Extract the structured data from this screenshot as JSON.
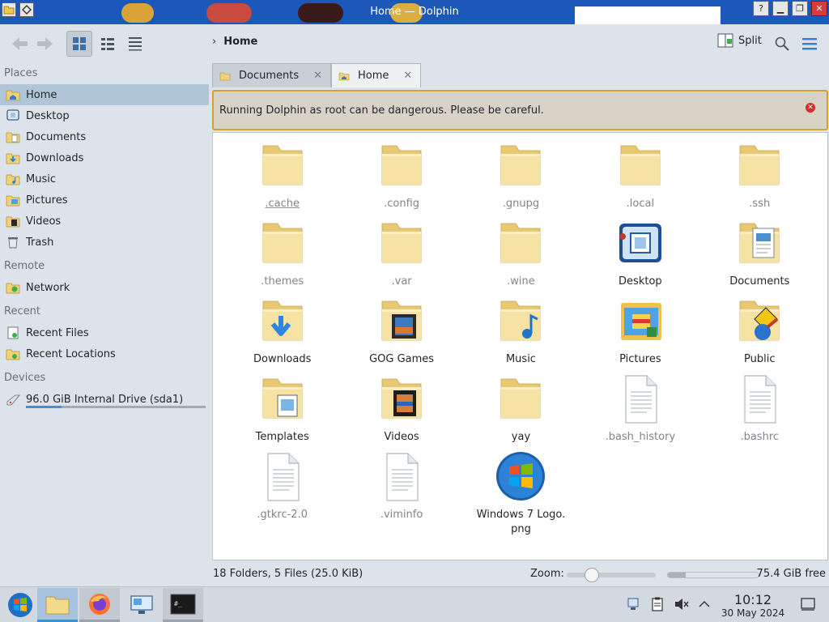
{
  "window": {
    "title": "Home — Dolphin",
    "controls": [
      "help",
      "minimize",
      "maximize",
      "close"
    ]
  },
  "toolbar": {
    "back_icon": "arrow-left-icon",
    "forward_icon": "arrow-right-icon",
    "view_modes": [
      "icons-view",
      "compact-view",
      "details-view"
    ],
    "active_view": "icons-view",
    "breadcrumb": [
      "Home"
    ],
    "split_label": "Split",
    "search_icon": "search-icon",
    "menu_icon": "hamburger-menu-icon"
  },
  "sidebar": {
    "places_header": "Places",
    "places": [
      {
        "label": "Home",
        "icon": "home-folder-icon",
        "active": true
      },
      {
        "label": "Desktop",
        "icon": "desktop-icon"
      },
      {
        "label": "Documents",
        "icon": "documents-folder-icon"
      },
      {
        "label": "Downloads",
        "icon": "downloads-folder-icon"
      },
      {
        "label": "Music",
        "icon": "music-folder-icon"
      },
      {
        "label": "Pictures",
        "icon": "pictures-folder-icon"
      },
      {
        "label": "Videos",
        "icon": "videos-folder-icon"
      },
      {
        "label": "Trash",
        "icon": "trash-icon"
      }
    ],
    "remote_header": "Remote",
    "remote": [
      {
        "label": "Network",
        "icon": "network-folder-icon"
      }
    ],
    "recent_header": "Recent",
    "recent": [
      {
        "label": "Recent Files",
        "icon": "recent-files-icon"
      },
      {
        "label": "Recent Locations",
        "icon": "recent-locations-icon"
      }
    ],
    "devices_header": "Devices",
    "devices": [
      {
        "label": "96.0 GiB Internal Drive (sda1)",
        "icon": "hard-drive-icon",
        "used_fraction": 0.2
      }
    ]
  },
  "tabs": [
    {
      "label": "Documents",
      "active": false
    },
    {
      "label": "Home",
      "active": true
    }
  ],
  "warning": {
    "message": "Running Dolphin as root can be dangerous. Please be careful."
  },
  "files": [
    {
      "name": ".cache",
      "type": "folder",
      "hidden": true,
      "current": true
    },
    {
      "name": ".config",
      "type": "folder",
      "hidden": true
    },
    {
      "name": ".gnupg",
      "type": "folder",
      "hidden": true
    },
    {
      "name": ".local",
      "type": "folder",
      "hidden": true
    },
    {
      "name": ".ssh",
      "type": "folder",
      "hidden": true
    },
    {
      "name": ".themes",
      "type": "folder",
      "hidden": true
    },
    {
      "name": ".var",
      "type": "folder",
      "hidden": true
    },
    {
      "name": ".wine",
      "type": "folder",
      "hidden": true
    },
    {
      "name": "Desktop",
      "type": "desktop"
    },
    {
      "name": "Documents",
      "type": "documents"
    },
    {
      "name": "Downloads",
      "type": "downloads"
    },
    {
      "name": "GOG Games",
      "type": "folder-pic"
    },
    {
      "name": "Music",
      "type": "music"
    },
    {
      "name": "Pictures",
      "type": "pictures"
    },
    {
      "name": "Public",
      "type": "public"
    },
    {
      "name": "Templates",
      "type": "templates"
    },
    {
      "name": "Videos",
      "type": "videos"
    },
    {
      "name": "yay",
      "type": "folder"
    },
    {
      "name": ".bash_history",
      "type": "file",
      "hidden": true
    },
    {
      "name": ".bashrc",
      "type": "file",
      "hidden": true
    },
    {
      "name": ".gtkrc-2.0",
      "type": "file",
      "hidden": true
    },
    {
      "name": ".viminfo",
      "type": "file",
      "hidden": true
    },
    {
      "name": "Windows 7 Logo.\npng",
      "type": "image-logo"
    }
  ],
  "statusbar": {
    "summary": "18 Folders, 5 Files (25.0 KiB)",
    "zoom_label": "Zoom:",
    "free_label": "75.4 GiB free",
    "used_fraction": 0.2
  },
  "taskbar": {
    "apps": [
      {
        "name": "start-menu",
        "icon": "windows-logo-icon"
      },
      {
        "name": "dolphin",
        "icon": "folder-icon",
        "state": "active"
      },
      {
        "name": "firefox",
        "icon": "firefox-icon",
        "state": "open"
      },
      {
        "name": "system-settings",
        "icon": "settings-monitor-icon"
      },
      {
        "name": "terminal",
        "icon": "terminal-icon",
        "state": "open"
      }
    ],
    "tray": [
      "network-icon",
      "clipboard-icon",
      "volume-muted-icon",
      "expand-tray-icon"
    ],
    "time": "10:12",
    "date": "30 May 2024",
    "show_desktop_icon": "show-desktop-icon"
  },
  "colors": {
    "accent": "#3d8ee8",
    "selection": "#b1c5d8",
    "warning_border": "#d2a135",
    "warning_bg": "#d7d3c6",
    "folder": "#f3dd93"
  }
}
